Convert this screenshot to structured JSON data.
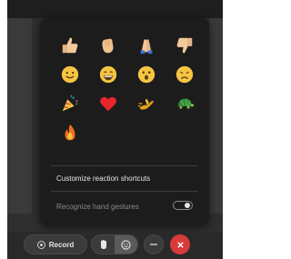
{
  "reactions": [
    {
      "name": "thumbs-up-icon"
    },
    {
      "name": "clap-icon"
    },
    {
      "name": "pray-icon"
    },
    {
      "name": "thumbs-down-icon"
    },
    {
      "name": "smile-icon"
    },
    {
      "name": "laugh-icon"
    },
    {
      "name": "surprised-icon"
    },
    {
      "name": "sad-icon"
    },
    {
      "name": "party-popper-icon"
    },
    {
      "name": "heart-icon"
    },
    {
      "name": "running-icon"
    },
    {
      "name": "turtle-icon"
    },
    {
      "name": "fire-icon"
    }
  ],
  "menu": {
    "customize_label": "Customize reaction shortcuts",
    "hand_gestures_label": "Recognize hand gestures",
    "hand_gestures_enabled": false
  },
  "toolbar": {
    "record_label": "Record"
  },
  "colors": {
    "panel": "#1c1c1c",
    "accent_leave": "#d83b3b",
    "emoji_yellow": "#f5c542",
    "heart": "#e8242d",
    "fire": "#f0701a",
    "turtle": "#2e8b3a"
  }
}
